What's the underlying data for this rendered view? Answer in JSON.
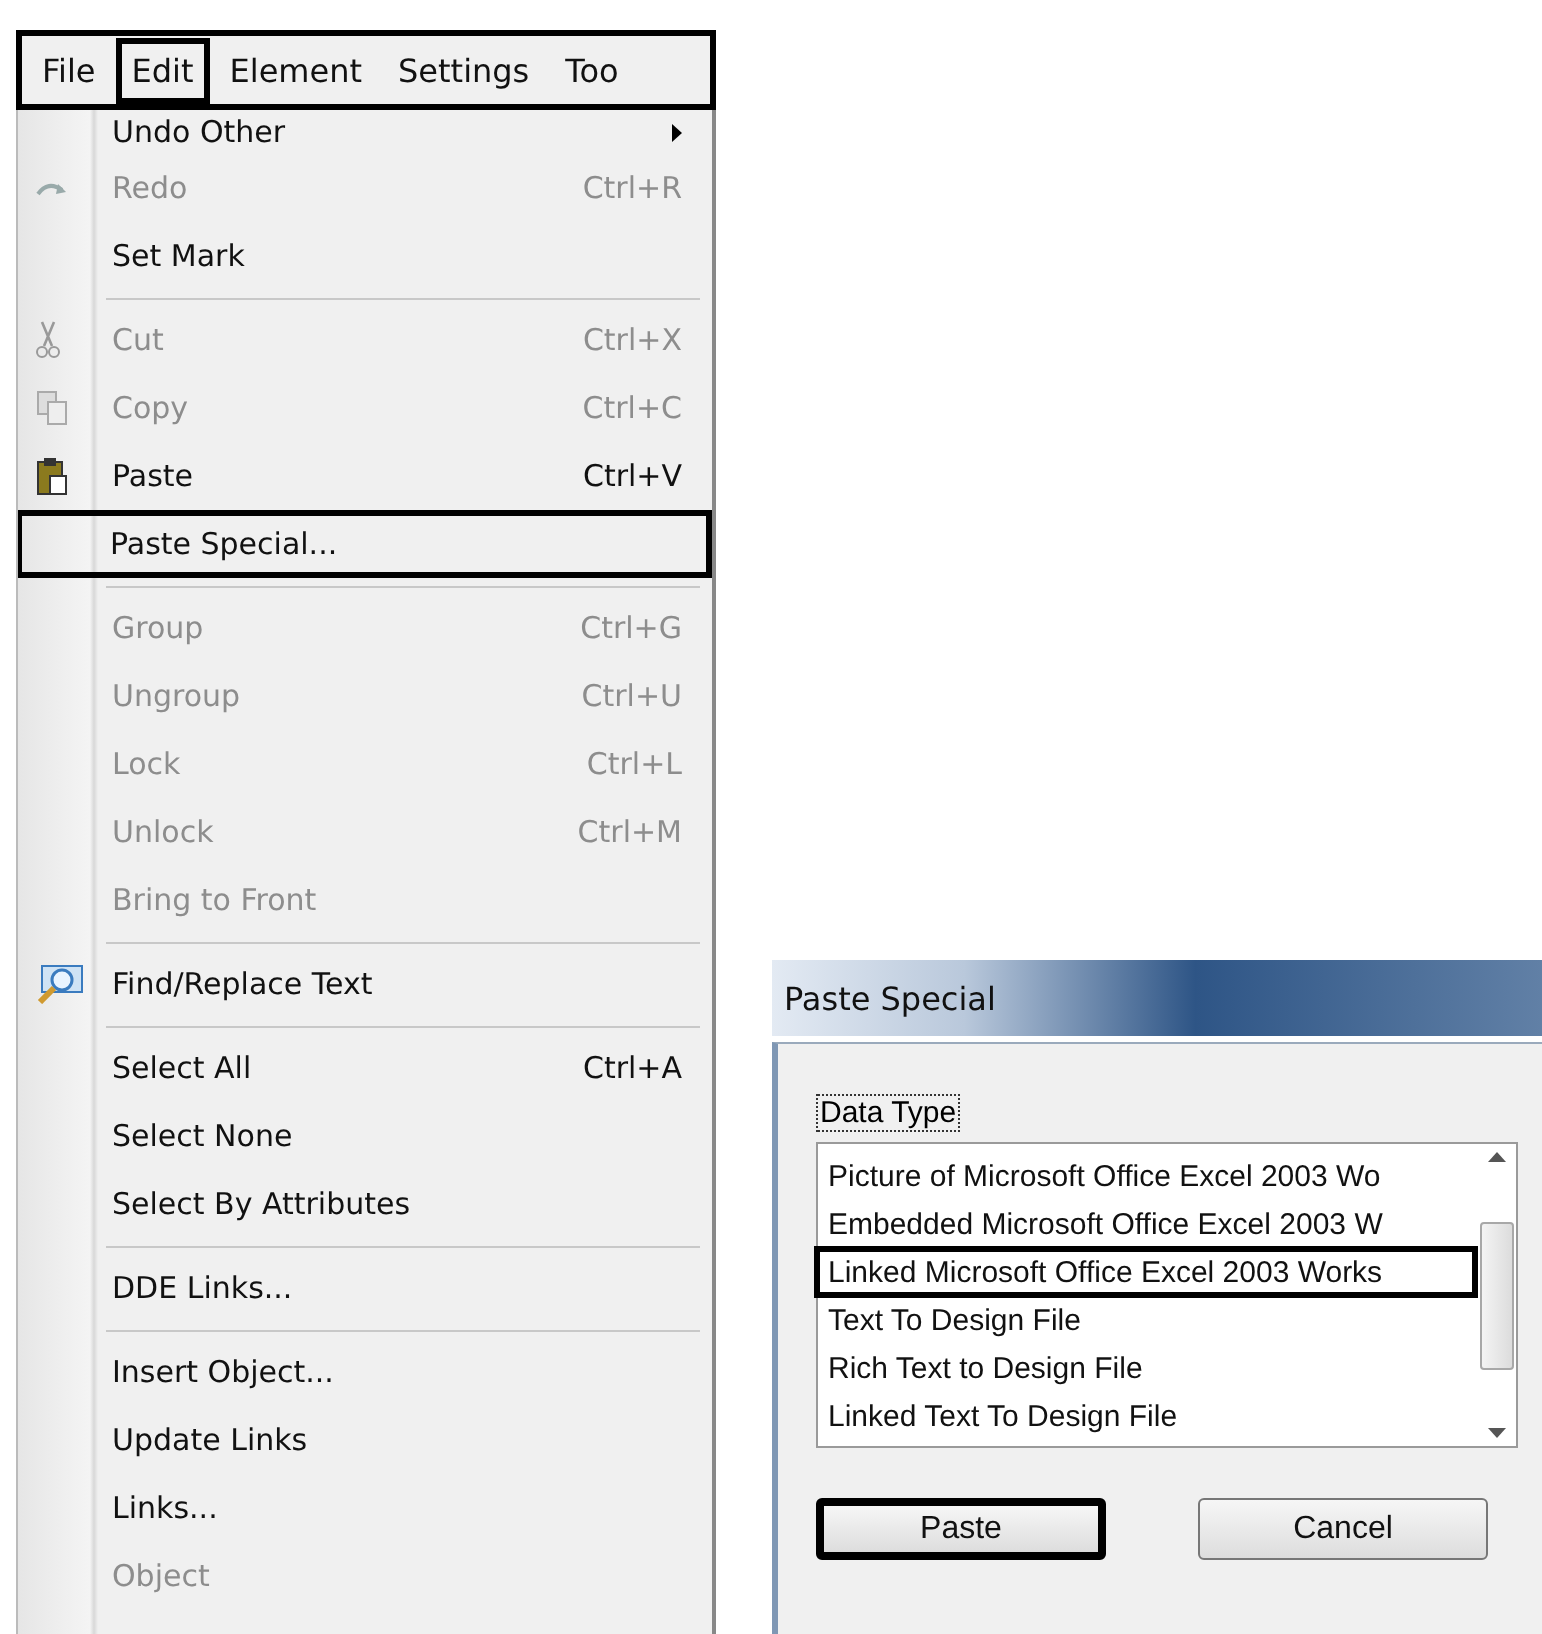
{
  "menu_bar": [
    {
      "label": "File",
      "highlighted": false
    },
    {
      "label": "Edit",
      "highlighted": true
    },
    {
      "label": "Element",
      "highlighted": false
    },
    {
      "label": "Settings",
      "highlighted": false
    },
    {
      "label": "Too",
      "highlighted": false
    }
  ],
  "edit_menu": [
    {
      "kind": "item",
      "label": "Undo Other",
      "submenu": true,
      "disabled": false,
      "highlighted": false
    },
    {
      "kind": "item",
      "label": "Redo",
      "shortcut": "Ctrl+R",
      "disabled": true,
      "highlighted": false
    },
    {
      "kind": "item",
      "label": "Set Mark",
      "disabled": false,
      "highlighted": false
    },
    {
      "kind": "separator"
    },
    {
      "kind": "item",
      "label": "Cut",
      "shortcut": "Ctrl+X",
      "disabled": true,
      "highlighted": false
    },
    {
      "kind": "item",
      "label": "Copy",
      "shortcut": "Ctrl+C",
      "disabled": true,
      "highlighted": false
    },
    {
      "kind": "item",
      "label": "Paste",
      "shortcut": "Ctrl+V",
      "disabled": false,
      "highlighted": false
    },
    {
      "kind": "item",
      "label": "Paste Special...",
      "disabled": false,
      "highlighted": true
    },
    {
      "kind": "separator"
    },
    {
      "kind": "item",
      "label": "Group",
      "shortcut": "Ctrl+G",
      "disabled": true,
      "highlighted": false
    },
    {
      "kind": "item",
      "label": "Ungroup",
      "shortcut": "Ctrl+U",
      "disabled": true,
      "highlighted": false
    },
    {
      "kind": "item",
      "label": "Lock",
      "shortcut": "Ctrl+L",
      "disabled": true,
      "highlighted": false
    },
    {
      "kind": "item",
      "label": "Unlock",
      "shortcut": "Ctrl+M",
      "disabled": true,
      "highlighted": false
    },
    {
      "kind": "item",
      "label": "Bring to Front",
      "disabled": true,
      "highlighted": false
    },
    {
      "kind": "separator"
    },
    {
      "kind": "item",
      "label": "Find/Replace Text",
      "disabled": false,
      "highlighted": false
    },
    {
      "kind": "separator"
    },
    {
      "kind": "item",
      "label": "Select All",
      "shortcut": "Ctrl+A",
      "disabled": false,
      "highlighted": false
    },
    {
      "kind": "item",
      "label": "Select None",
      "disabled": false,
      "highlighted": false
    },
    {
      "kind": "item",
      "label": "Select By Attributes",
      "disabled": false,
      "highlighted": false
    },
    {
      "kind": "separator"
    },
    {
      "kind": "item",
      "label": "DDE Links...",
      "disabled": false,
      "highlighted": false
    },
    {
      "kind": "separator"
    },
    {
      "kind": "item",
      "label": "Insert Object...",
      "disabled": false,
      "highlighted": false
    },
    {
      "kind": "item",
      "label": "Update Links",
      "disabled": false,
      "highlighted": false
    },
    {
      "kind": "item",
      "label": "Links...",
      "disabled": false,
      "highlighted": false
    },
    {
      "kind": "item",
      "label": "Object",
      "disabled": true,
      "highlighted": false
    }
  ],
  "dialog": {
    "title": "Paste Special",
    "group_label": "Data Type",
    "data_types": [
      {
        "label": "Picture of Microsoft Office Excel 2003 Wo",
        "highlighted": false
      },
      {
        "label": "Embedded Microsoft Office Excel 2003 W",
        "highlighted": false
      },
      {
        "label": "Linked Microsoft Office Excel 2003 Works",
        "highlighted": true
      },
      {
        "label": "Text To Design File",
        "highlighted": false
      },
      {
        "label": "Rich Text to Design File",
        "highlighted": false
      },
      {
        "label": "Linked Text To Design File",
        "highlighted": false
      }
    ],
    "buttons": [
      {
        "label": "Paste",
        "highlighted": true
      },
      {
        "label": "Cancel",
        "highlighted": false
      }
    ]
  }
}
